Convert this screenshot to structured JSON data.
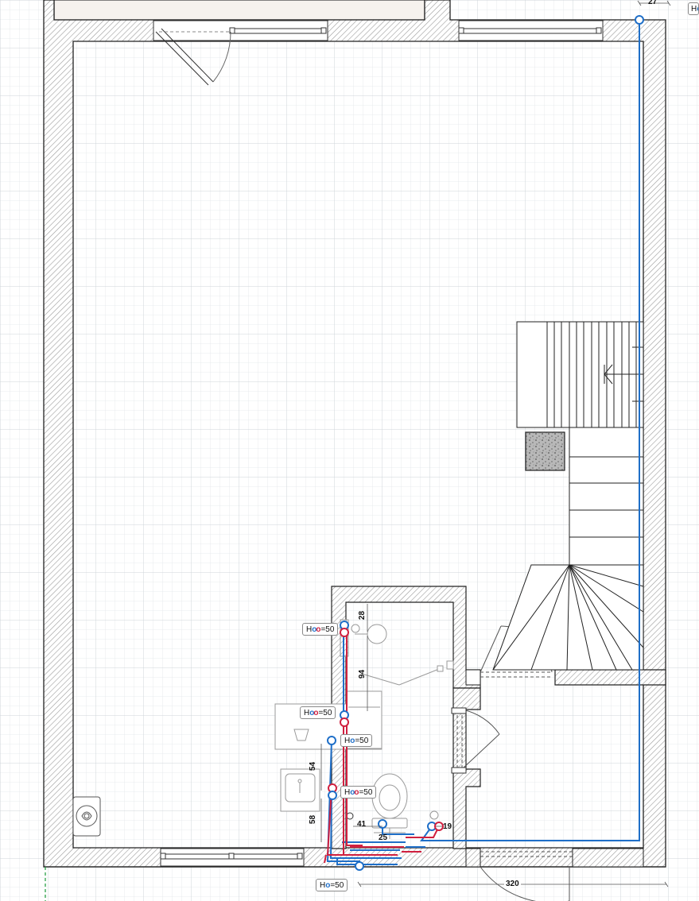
{
  "plan": {
    "riser_labels": [
      {
        "id": "cw-hw-top",
        "letter": "H",
        "cold": true,
        "hot": true,
        "value": "=50"
      },
      {
        "id": "cw-hw-mid",
        "letter": "H",
        "cold": true,
        "hot": true,
        "value": "=50"
      },
      {
        "id": "cw-only-mid",
        "letter": "H",
        "cold": true,
        "hot": false,
        "value": "=50"
      },
      {
        "id": "cw-hw-low",
        "letter": "H",
        "cold": true,
        "hot": true,
        "value": "=50"
      },
      {
        "id": "cw-bottom",
        "letter": "H",
        "cold": true,
        "hot": false,
        "value": "=50"
      },
      {
        "id": "cw-top-right",
        "letter": "H",
        "cold": true,
        "hot": false,
        "value": ""
      }
    ],
    "dimensions": {
      "top_right": "27",
      "sink_offset": "28",
      "shower_span": "94",
      "basin_gap": "54",
      "lower_gap": "58",
      "wc_left": "41",
      "wc_below": "25",
      "wc_right": "19",
      "overall_bottom": "320"
    },
    "colors": {
      "cold_water": "#1f6fc8",
      "hot_water": "#d0203f",
      "wall_fill": "#bdbdbd",
      "grid_line": "#d9dde3",
      "fixture_line": "#9a9a9a"
    },
    "icons": {
      "boiler": "boiler-icon",
      "chimney": "chimney-icon",
      "stairs_arrow": "stairs-arrow-icon"
    }
  }
}
